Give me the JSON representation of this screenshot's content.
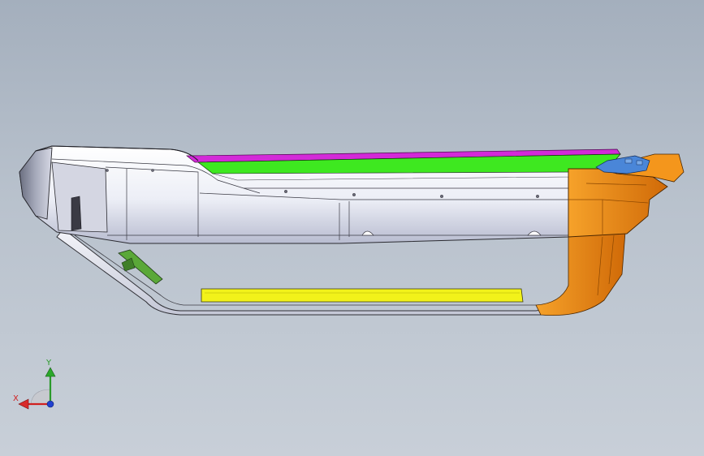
{
  "viewport": {
    "background_top": "#a4afbd",
    "background_bottom": "#c8cfd8"
  },
  "model": {
    "parts": [
      {
        "name": "main-housing",
        "color": "#eceef6"
      },
      {
        "name": "top-cover-magenta",
        "color": "#d32ad8"
      },
      {
        "name": "top-panel-green",
        "color": "#3ee820"
      },
      {
        "name": "end-cap-orange",
        "color": "#f08a10"
      },
      {
        "name": "bracket-blue",
        "color": "#4a86d8"
      },
      {
        "name": "rail-yellow",
        "color": "#f2f21a"
      },
      {
        "name": "clip-green",
        "color": "#5aa838"
      },
      {
        "name": "frame-loop",
        "color": "#e2e4ee"
      }
    ]
  },
  "triad": {
    "x_label": "X",
    "y_label": "Y",
    "x_color": "#d02020",
    "y_color": "#2a9a2a",
    "z_color": "#2040d0"
  }
}
